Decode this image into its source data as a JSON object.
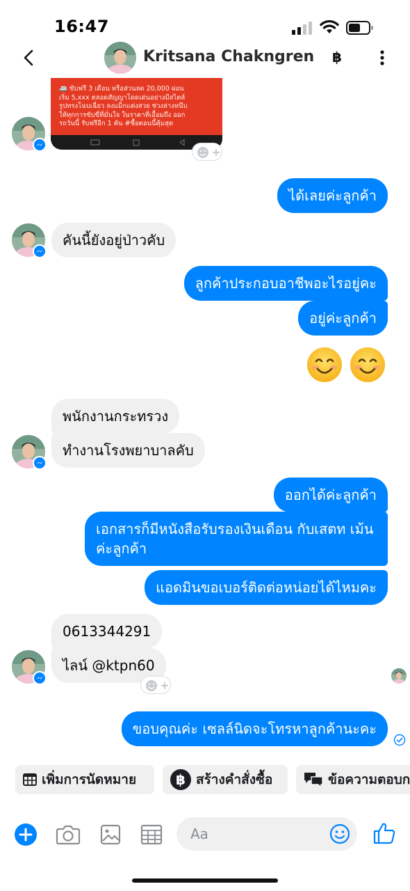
{
  "status_bar": {
    "time": "16:47"
  },
  "header": {
    "name": "Kritsana Chakngren",
    "currency_symbol": "฿"
  },
  "image_message": {
    "ad_lines": [
      "🚐 ขับฟรี 3 เดือน หรือส่วนลด 20,000 ผ่อน",
      "เริ่ม 5,xxx ตลอดสัญญาโดดเด่นอย่างมีสไตล์",
      "รูปทรงโฉบเฉี่ยว ลงแม็กแต่งสวย ช่วงล่างหนึบ",
      "ให้ทุกการขับขี่ที่มั่นใจ ในราคาที่เอื้อมถึง ออก",
      "รถวันนี้ รับฟรีอีก 1 คัน #ซื้อตอนนี้คุ้มสุด"
    ]
  },
  "messages": {
    "m1": "ได้เลยค่ะลูกค้า",
    "m2": "คันนี้ยังอยู่ป่าวคับ",
    "m3": "ลูกค้าประกอบอาชีพอะไรอยู่คะ",
    "m4": "อยู่ค่ะลูกค้า",
    "m5": "พนักงานกระทรวง",
    "m6": "ทำงานโรงพยาบาลคับ",
    "m7": "ออกได้ค่ะลูกค้า",
    "m8": "เอกสารก็มีหนังสือรับรองเงินเดือน กับเสตท เม้นค่ะลูกค้า",
    "m9": "แอดมินขอเบอร์ติดต่อหน่อยได้ไหมคะ",
    "m10": "0613344291",
    "m11": "ไลน์ @ktpn60",
    "m12": "ขอบคุณค่ะ เซลล์นิดจะโทรหาลูกค้านะคะ"
  },
  "quick_actions": {
    "appointment": "เพิ่มการนัดหมาย",
    "create_order": "สร้างคำสั่งซื้อ",
    "saved_replies": "ข้อความตอบกลับ"
  },
  "composer": {
    "placeholder": "Aa"
  },
  "colors": {
    "outgoing": "#0084ff",
    "incoming": "#f0f0f0",
    "accent": "#0084ff"
  }
}
